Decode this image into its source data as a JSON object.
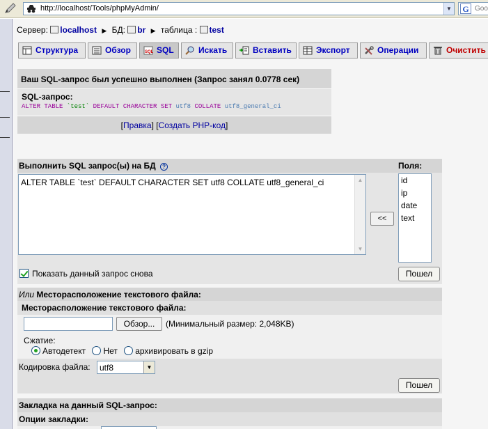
{
  "browser": {
    "url": "http://localhost/Tools/phpMyAdmin/",
    "search_fragment": "Goo"
  },
  "breadcrumb": {
    "server_label": "Сервер:",
    "server": "localhost",
    "db_label": "БД:",
    "db": "br",
    "table_label": "таблица :",
    "table": "test"
  },
  "tabs": [
    {
      "label": "Структура",
      "icon": "structure-icon"
    },
    {
      "label": "Обзор",
      "icon": "browse-icon"
    },
    {
      "label": "SQL",
      "icon": "sql-icon"
    },
    {
      "label": "Искать",
      "icon": "search-icon"
    },
    {
      "label": "Вставить",
      "icon": "insert-icon"
    },
    {
      "label": "Экспорт",
      "icon": "export-icon"
    },
    {
      "label": "Операции",
      "icon": "operations-icon"
    },
    {
      "label": "Очистить",
      "icon": "empty-icon"
    }
  ],
  "success": {
    "message": "Ваш SQL-запрос был успешно выполнен (Запрос занял 0.0778 сек)",
    "query_label": "SQL-запрос:",
    "query": {
      "kw1": "ALTER TABLE",
      "tbl": "`test`",
      "kw2": "DEFAULT CHARACTER SET",
      "v1": "utf8",
      "kw3": "COLLATE",
      "v2": "utf8_general_ci"
    },
    "edit_link": "Правка",
    "php_link": "Создать PHP-код"
  },
  "sql_form": {
    "heading": "Выполнить SQL запрос(ы) на БД",
    "fields_heading": "Поля:",
    "query_text": "ALTER TABLE `test` DEFAULT CHARACTER SET utf8 COLLATE utf8_general_ci",
    "insert_button": "<<",
    "fields": [
      "id",
      "ip",
      "date",
      "text"
    ],
    "show_again_label": "Показать данный запрос снова",
    "show_again_checked": true,
    "go_button": "Пошел"
  },
  "file_section": {
    "heading_or": "Или",
    "heading": "Месторасположение текстового файла:",
    "subheading": "Месторасположение текстового файла:",
    "browse_button": "Обзор...",
    "min_size": "(Минимальный размер: 2,048KB)",
    "compression_label": "Сжатие:",
    "compression_options": [
      "Автодетект",
      "Нет",
      "архивировать в gzip"
    ],
    "compression_selected": "Автодетект",
    "encoding_label": "Кодировка файла:",
    "encoding_value": "utf8",
    "go_button": "Пошел"
  },
  "bookmark": {
    "heading": "Закладка на данный SQL-запрос:",
    "options_label": "Опции закладки:"
  }
}
